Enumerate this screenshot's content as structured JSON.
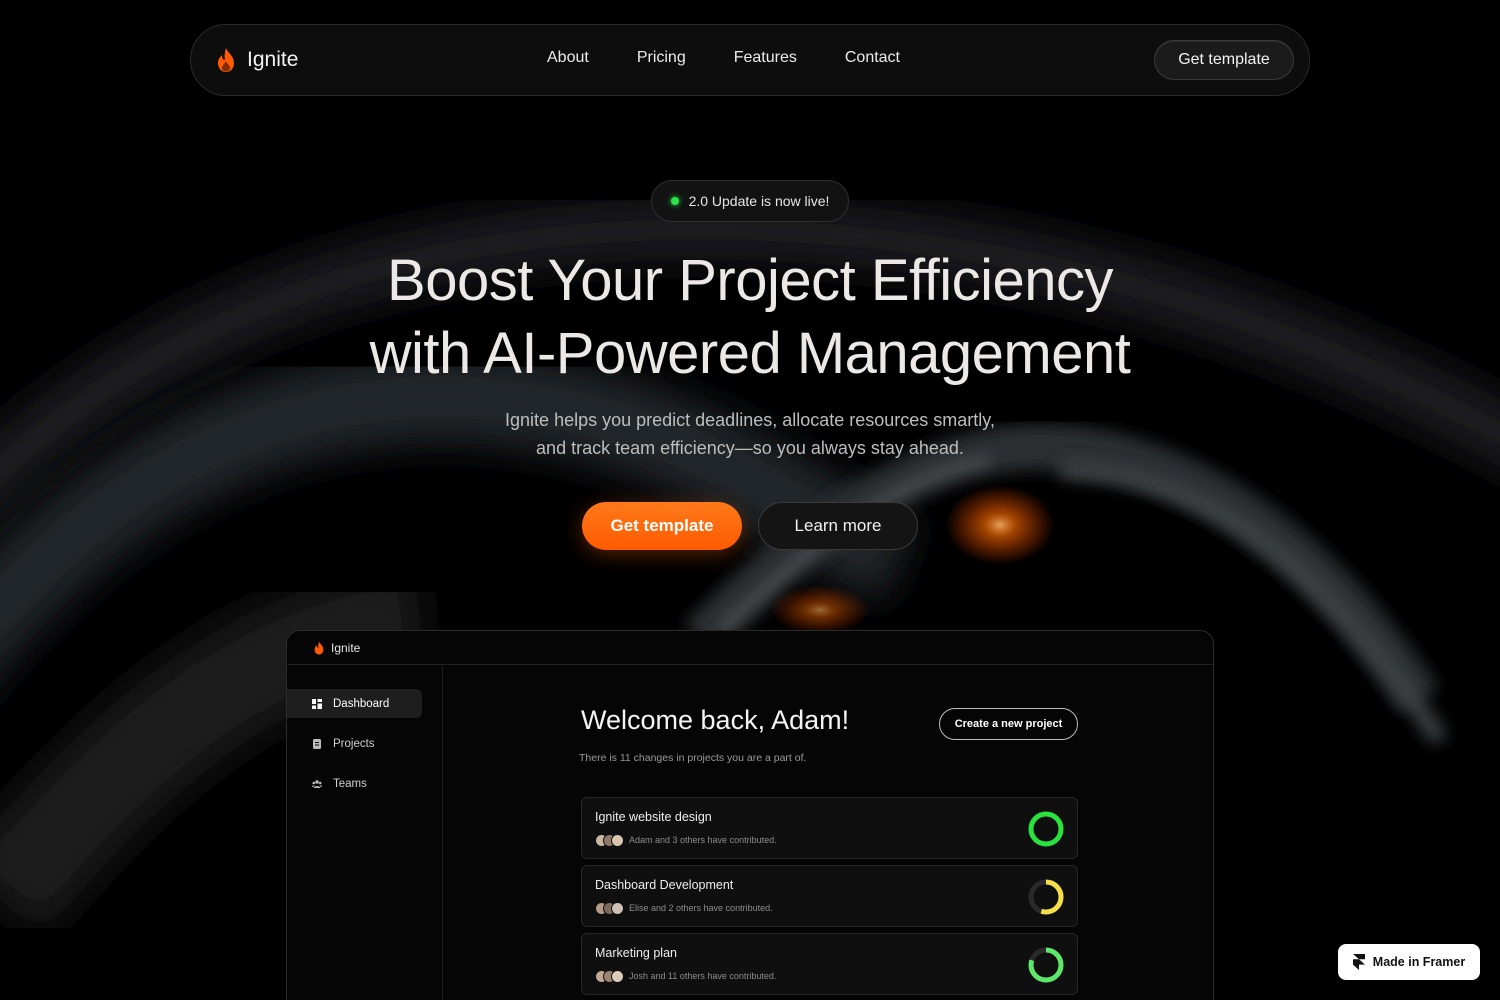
{
  "nav": {
    "brand": "Ignite",
    "links": [
      "About",
      "Pricing",
      "Features",
      "Contact"
    ],
    "cta": "Get template"
  },
  "hero": {
    "badge": "2.0 Update is now live!",
    "headline_line1": "Boost Your Project Efficiency",
    "headline_line2": "with AI-Powered Management",
    "sub_line1": "Ignite helps you predict deadlines, allocate resources smartly,",
    "sub_line2": "and track team efficiency—so you always stay ahead.",
    "cta_primary": "Get template",
    "cta_secondary": "Learn more",
    "accent_color": "#ff5a00"
  },
  "app": {
    "brand": "Ignite",
    "sidebar": [
      {
        "label": "Dashboard",
        "icon": "dashboard-icon",
        "active": true
      },
      {
        "label": "Projects",
        "icon": "projects-icon",
        "active": false
      },
      {
        "label": "Teams",
        "icon": "teams-icon",
        "active": false
      }
    ],
    "welcome": "Welcome back, Adam!",
    "create_button": "Create a new project",
    "changes": "There is 11 changes in projects you are a part of.",
    "projects": [
      {
        "name": "Ignite website design",
        "contributors": "Adam and 3 others have contributed.",
        "progress": 1.0,
        "color": "#27e33c"
      },
      {
        "name": "Dashboard Development",
        "contributors": "Elise and 2 others have contributed.",
        "progress": 0.55,
        "color": "#f5e04a"
      },
      {
        "name": "Marketing plan",
        "contributors": "Josh and 11 others have contributed.",
        "progress": 0.8,
        "color": "#5ee86a"
      }
    ]
  },
  "badge": {
    "label": "Made in Framer"
  }
}
